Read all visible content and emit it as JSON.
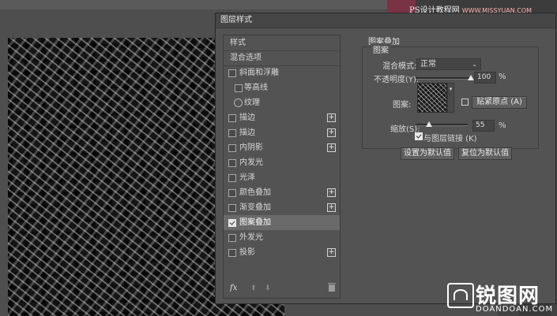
{
  "document": {
    "top_watermark": "PS设计教程网",
    "top_watermark_url": "WWW.MISSYUAN.COM"
  },
  "dialog": {
    "title": "图层样式",
    "style_list": [
      {
        "label": "样式",
        "kind": "plain"
      },
      {
        "label": "混合选项",
        "kind": "plain"
      },
      {
        "label": "斜面和浮雕",
        "kind": "check",
        "checked": false,
        "plus": false
      },
      {
        "label": "等高线",
        "kind": "sub-check",
        "checked": false
      },
      {
        "label": "纹理",
        "kind": "sub-ring"
      },
      {
        "label": "描边",
        "kind": "check",
        "checked": false,
        "plus": true
      },
      {
        "label": "描边",
        "kind": "check",
        "checked": false,
        "plus": true
      },
      {
        "label": "内阴影",
        "kind": "check",
        "checked": false,
        "plus": true
      },
      {
        "label": "内发光",
        "kind": "check",
        "checked": false,
        "plus": false
      },
      {
        "label": "光泽",
        "kind": "check",
        "checked": false,
        "plus": false
      },
      {
        "label": "颜色叠加",
        "kind": "check",
        "checked": false,
        "plus": true
      },
      {
        "label": "渐变叠加",
        "kind": "check",
        "checked": false,
        "plus": true
      },
      {
        "label": "图案叠加",
        "kind": "check",
        "checked": true,
        "plus": false,
        "selected": true
      },
      {
        "label": "外发光",
        "kind": "check",
        "checked": false,
        "plus": false
      },
      {
        "label": "投影",
        "kind": "check",
        "checked": false,
        "plus": true
      }
    ],
    "footer": {
      "fx": "fx"
    },
    "panel": {
      "title": "图案叠加",
      "group": "图案",
      "blend_mode_label": "混合模式:",
      "blend_mode_value": "正常",
      "opacity_label": "不透明度(Y):",
      "opacity_value": "100",
      "opacity_unit": "%",
      "opacity_fraction": 1.0,
      "pattern_label": "图案:",
      "snap_button": "贴紧原点 (A)",
      "scale_label": "缩放(S):",
      "scale_value": "55",
      "scale_unit": "%",
      "scale_fraction": 0.25,
      "link_label": "与图层链接 (K)",
      "link_checked": true,
      "make_default_button": "设置为默认值",
      "reset_default_button": "复位为默认值"
    }
  },
  "brand": {
    "name": "锐图网",
    "url": "DOANDOAN.COM"
  },
  "colors": {
    "dialog_bg": "#535353",
    "selected_row": "#6a6a6a",
    "canvas_bg": "#151515"
  }
}
